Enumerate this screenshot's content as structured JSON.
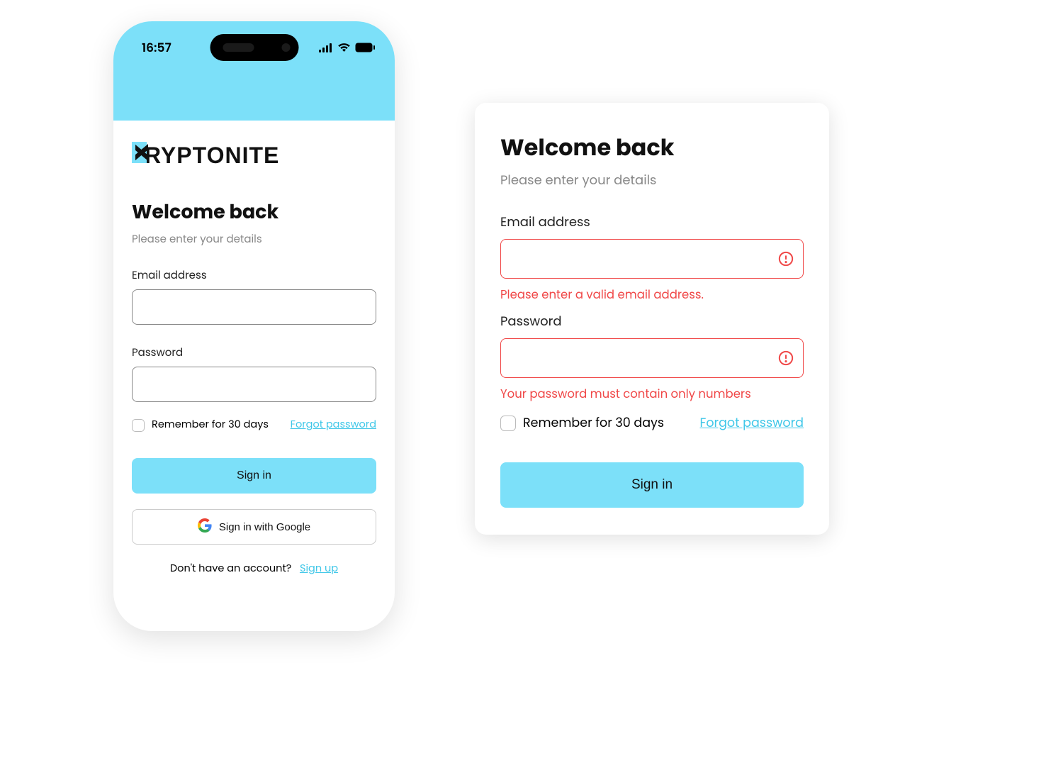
{
  "phone": {
    "status": {
      "time": "16:57"
    },
    "brand_rest": "RYPTONITE",
    "welcome_title": "Welcome back",
    "welcome_sub": "Please enter your details",
    "email_label": "Email address",
    "password_label": "Password",
    "remember_label": "Remember for 30 days",
    "forgot_label": "Forgot password",
    "signin_label": "Sign in",
    "google_label": "Sign in with Google",
    "no_account_label": "Don't have an account?",
    "signup_label": "Sign up"
  },
  "card": {
    "welcome_title": "Welcome back",
    "welcome_sub": "Please enter your details",
    "email_label": "Email address",
    "email_error": "Please enter a valid email address.",
    "password_label": "Password",
    "password_error": "Your password must contain only numbers",
    "remember_label": "Remember for 30 days",
    "forgot_label": "Forgot password",
    "signin_label": "Sign in"
  },
  "colors": {
    "accent": "#7CE0F9",
    "error": "#F04848",
    "link": "#40C7E8"
  }
}
